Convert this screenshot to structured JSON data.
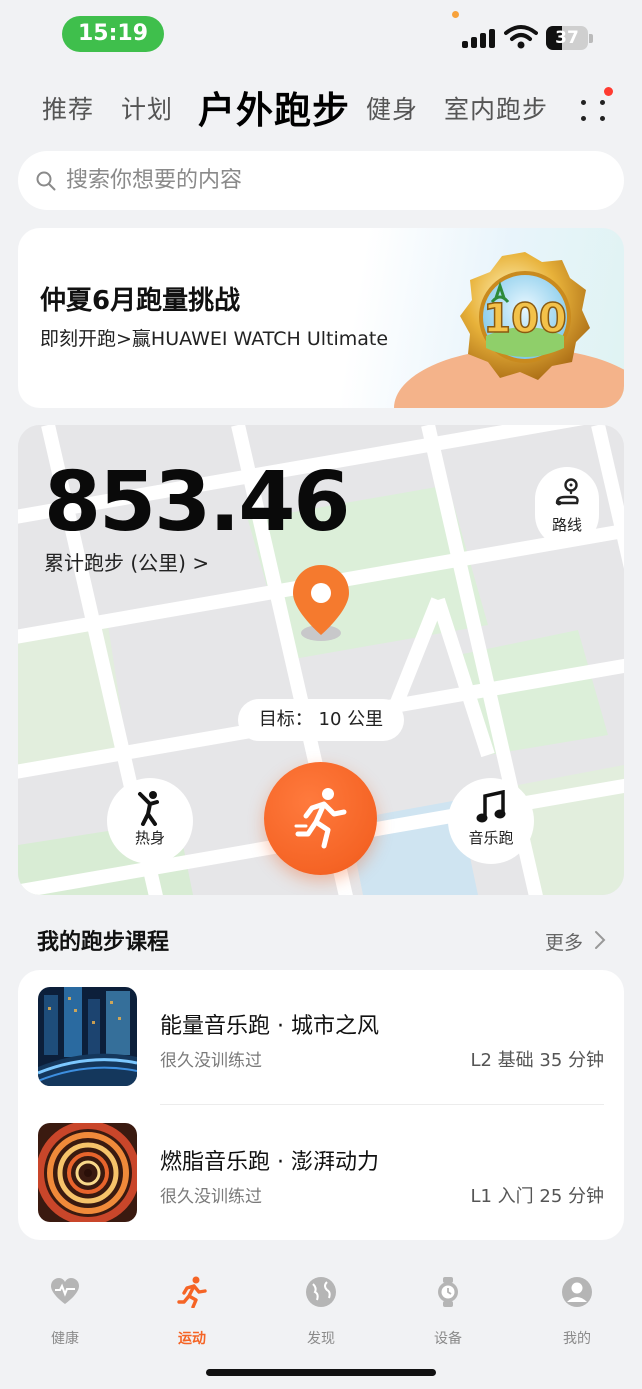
{
  "status_bar": {
    "time": "15:19",
    "battery": "37",
    "battery_level": 0.37
  },
  "top_tabs": [
    {
      "label": "推荐",
      "active": false
    },
    {
      "label": "计划",
      "active": false
    },
    {
      "label": "户外跑步",
      "active": true
    },
    {
      "label": "健身",
      "active": false
    },
    {
      "label": "室内跑步",
      "active": false
    }
  ],
  "search": {
    "placeholder": "搜索你想要的内容"
  },
  "banner": {
    "title": "仲夏6月跑量挑战",
    "subtitle": "即刻开跑>赢HUAWEI WATCH Ultimate",
    "medal_text": "100"
  },
  "run_card": {
    "distance": "853.46",
    "distance_label": "累计跑步 (公里) >",
    "route_label": "路线",
    "goal": "目标：  10 公里",
    "warmup_label": "热身",
    "music_run_label": "音乐跑"
  },
  "courses": {
    "title": "我的跑步课程",
    "more": "更多",
    "items": [
      {
        "title": "能量音乐跑 · 城市之风",
        "status": "很久没训练过",
        "meta": "L2 基础 35 分钟"
      },
      {
        "title": "燃脂音乐跑 · 澎湃动力",
        "status": "很久没训练过",
        "meta": "L1 入门 25 分钟"
      }
    ]
  },
  "bottom_nav": [
    {
      "label": "健康",
      "icon": "heart-icon",
      "active": false
    },
    {
      "label": "运动",
      "icon": "runner-icon",
      "active": true
    },
    {
      "label": "发现",
      "icon": "globe-icon",
      "active": false
    },
    {
      "label": "设备",
      "icon": "watch-icon",
      "active": false
    },
    {
      "label": "我的",
      "icon": "profile-icon",
      "active": false
    }
  ],
  "colors": {
    "accent": "#f56425",
    "status_green": "#3fbf4c",
    "map_green": "#dcefd9"
  }
}
